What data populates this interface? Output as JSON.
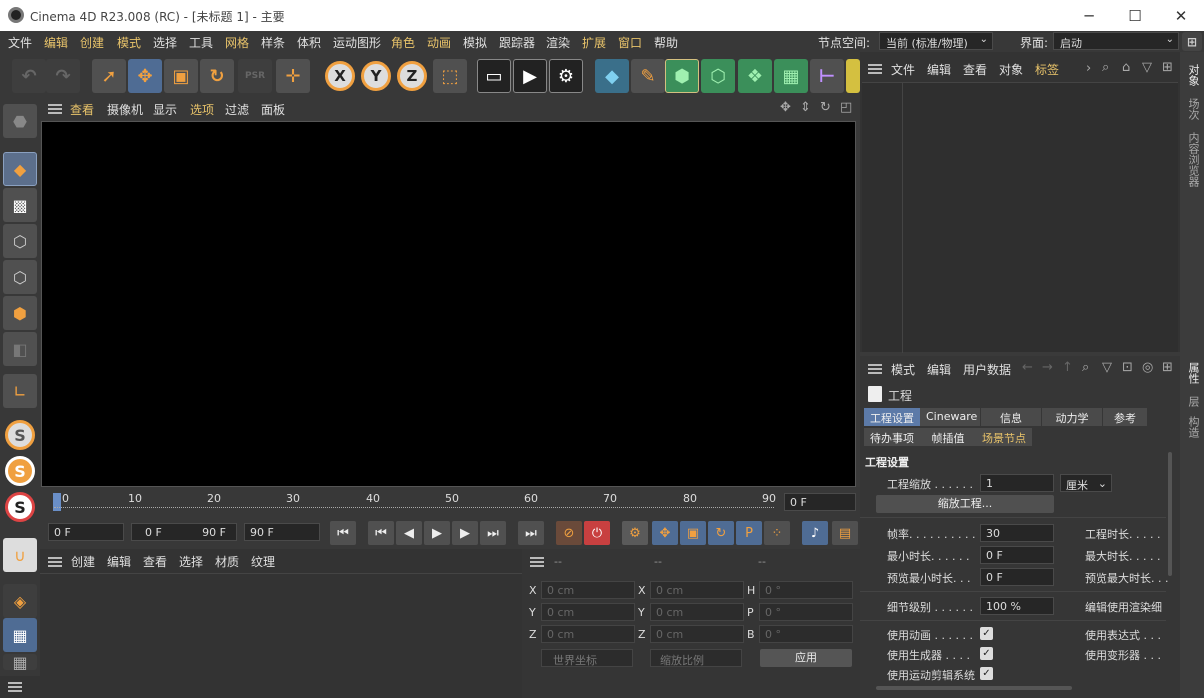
{
  "window": {
    "title": "Cinema 4D R23.008 (RC) - [未标题 1] - 主要",
    "minimize": "─",
    "maximize": "☐",
    "close": "✕"
  },
  "menu": [
    "文件",
    "编辑",
    "创建",
    "模式",
    "选择",
    "工具",
    "网格",
    "样条",
    "体积",
    "运动图形",
    "角色",
    "动画",
    "模拟",
    "跟踪器",
    "渲染",
    "扩展",
    "窗口",
    "帮助"
  ],
  "node_space": {
    "label": "节点空间:",
    "value": "当前 (标准/物理)"
  },
  "interface": {
    "label": "界面:",
    "value": "启动"
  },
  "toolbar": {
    "undo": "↶",
    "redo": "↷",
    "select": "➚",
    "move": "✥",
    "scale": "▣",
    "rotate": "↻",
    "psr": "PSR",
    "add": "✛",
    "x": "X",
    "y": "Y",
    "z": "Z",
    "coord": "⬚"
  },
  "viewport": {
    "menu": [
      "查看",
      "摄像机",
      "显示",
      "选项",
      "过滤",
      "面板"
    ]
  },
  "timeline": {
    "ticks": [
      "0",
      "10",
      "20",
      "30",
      "40",
      "50",
      "60",
      "70",
      "80",
      "90"
    ],
    "current": "0 F"
  },
  "transport": {
    "start": "0 F",
    "range_start": "0 F",
    "range_end": "90 F",
    "end": "90 F"
  },
  "material": {
    "menu": [
      "创建",
      "编辑",
      "查看",
      "选择",
      "材质",
      "纹理"
    ]
  },
  "coords": {
    "headers": [
      "--",
      "--",
      "--"
    ],
    "rows": [
      {
        "a": "X",
        "av": "0 cm",
        "b": "X",
        "bv": "0 cm",
        "c": "H",
        "cv": "0 °"
      },
      {
        "a": "Y",
        "av": "0 cm",
        "b": "Y",
        "bv": "0 cm",
        "c": "P",
        "cv": "0 °"
      },
      {
        "a": "Z",
        "av": "0 cm",
        "b": "Z",
        "bv": "0 cm",
        "c": "B",
        "cv": "0 °"
      }
    ],
    "world": "世界坐标",
    "scale": "缩放比例",
    "apply": "应用"
  },
  "objects": {
    "menu": [
      "文件",
      "编辑",
      "查看",
      "对象",
      "标签"
    ]
  },
  "attributes": {
    "menu": [
      "模式",
      "编辑",
      "用户数据"
    ],
    "title": "工程",
    "tabs1": [
      "工程设置",
      "Cineware",
      "信息",
      "动力学",
      "参考"
    ],
    "tabs2": [
      "待办事项",
      "帧插值",
      "场景节点"
    ],
    "section": "工程设置",
    "scale_label": "工程缩放 . . . . . .",
    "scale_value": "1",
    "scale_unit": "厘米",
    "scale_btn": "缩放工程...",
    "fps_label": "帧率. . . . . . . . . . .",
    "fps_value": "30",
    "min_label": "最小时长. . . . . .",
    "min_value": "0 F",
    "pmin_label": "预览最小时长. . .",
    "pmin_value": "0 F",
    "lod_label": "细节级别 . . . . . .",
    "lod_value": "100 %",
    "right_labels": [
      "工程时长. . . . .",
      "最大时长. . . . .",
      "预览最大时长. . .",
      "编辑使用渲染细"
    ],
    "use_anim": "使用动画 . . . . . .",
    "use_gen": "使用生成器 . . . .",
    "use_mograph": "使用运动剪辑系统",
    "use_expr": "使用表达式 . . .",
    "use_deform": "使用变形器 . . .",
    "check": "✓"
  },
  "side_tabs": [
    "对象",
    "场次",
    "内容浏览器",
    "属性",
    "层",
    "构造"
  ]
}
